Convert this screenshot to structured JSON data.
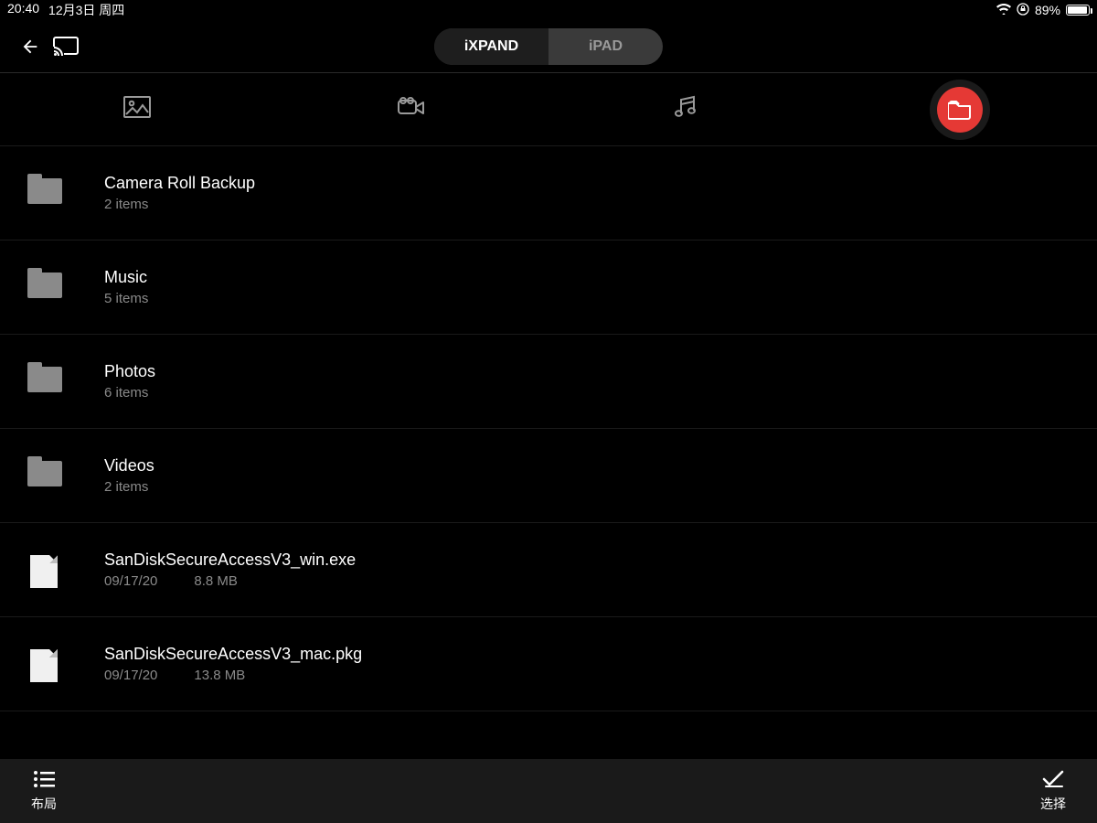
{
  "status": {
    "time": "20:40",
    "date": "12月3日 周四",
    "battery_pct": "89%",
    "battery_fill_width": "87%"
  },
  "segment": {
    "tab1": "iXPAND",
    "tab2": "iPAD"
  },
  "rows": [
    {
      "type": "folder",
      "title": "Camera Roll Backup",
      "sub": "2 items"
    },
    {
      "type": "folder",
      "title": "Music",
      "sub": "5 items"
    },
    {
      "type": "folder",
      "title": "Photos",
      "sub": "6 items"
    },
    {
      "type": "folder",
      "title": "Videos",
      "sub": "2 items"
    },
    {
      "type": "file",
      "title": "SanDiskSecureAccessV3_win.exe",
      "date": "09/17/20",
      "size": "8.8 MB"
    },
    {
      "type": "file",
      "title": "SanDiskSecureAccessV3_mac.pkg",
      "date": "09/17/20",
      "size": "13.8 MB"
    }
  ],
  "bottom": {
    "layout": "布局",
    "select": "选择"
  }
}
